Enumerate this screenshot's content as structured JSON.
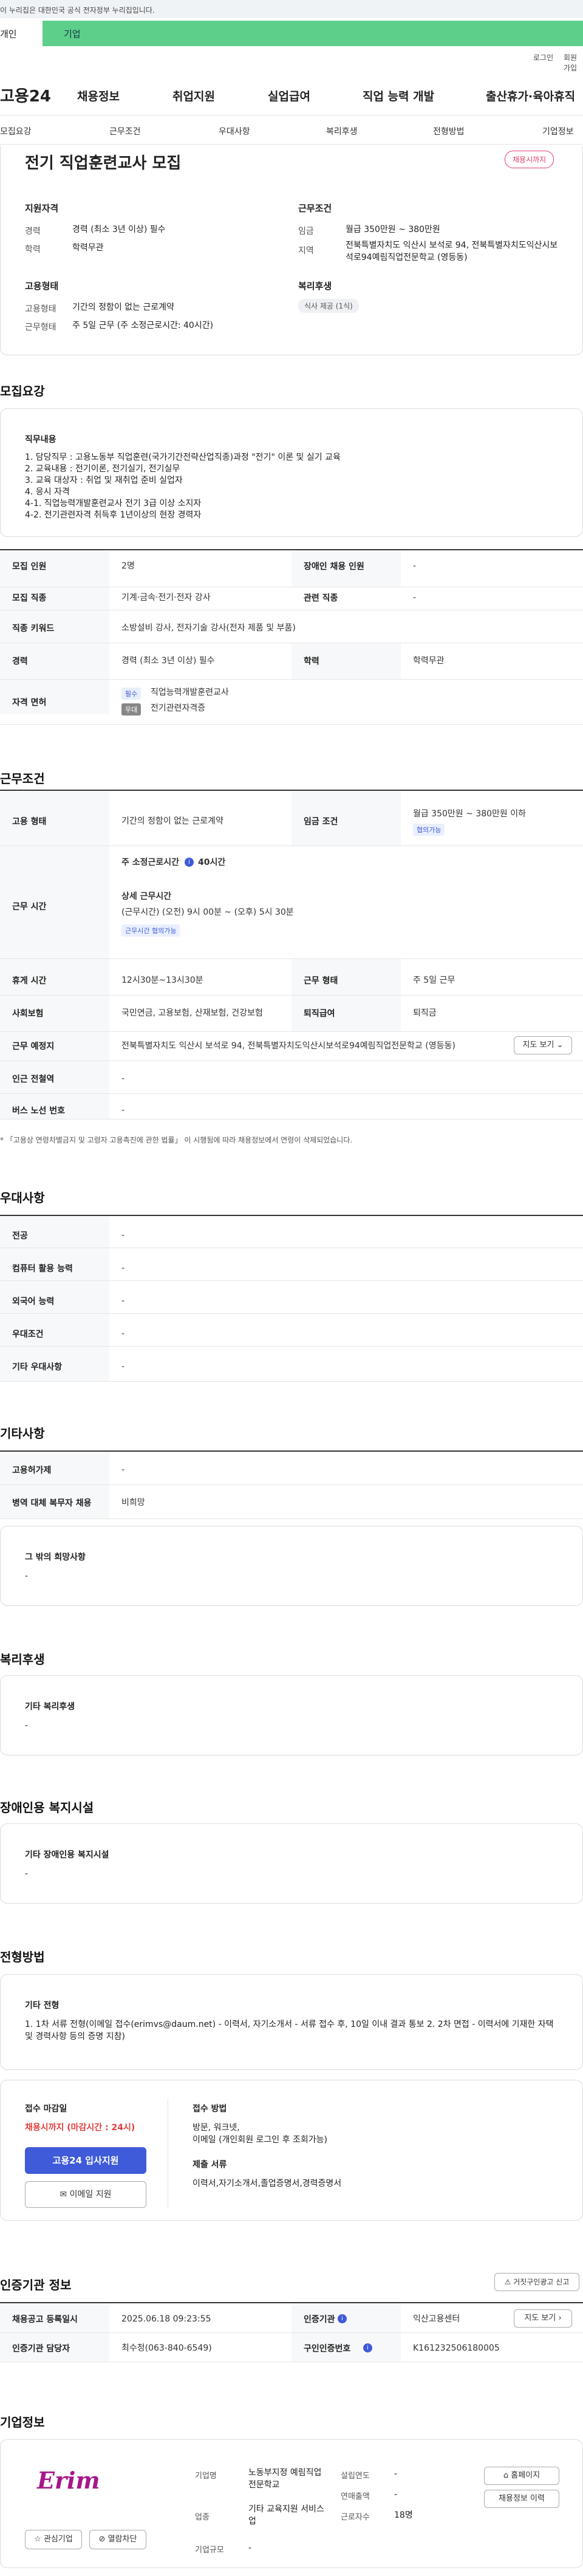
{
  "top_banner": {
    "text": "이 누리집은 대한민국 공식 전자정부 누리집입니다."
  },
  "gov_tabs": [
    "개인",
    "기업"
  ],
  "utils": {
    "login": "로그인",
    "signup": "회원가입"
  },
  "gnb": {
    "logo": "고용24",
    "menus": [
      "채용정보",
      "취업지원",
      "실업급여",
      "직업 능력 개발",
      "출산휴가·육아휴직"
    ]
  },
  "anchors": [
    "모집요강",
    "근무조건",
    "우대사항",
    "복리후생",
    "전형방법",
    "기업정보"
  ],
  "summary": {
    "title": "전기 직업훈련교사 모집",
    "status": "채용시까지",
    "left_section": "지원자격",
    "career_label": "경력",
    "career_value": "경력 (최소 3년 이상) 필수",
    "edu_label": "학력",
    "edu_value": "학력무관",
    "right_section": "근무조건",
    "wage_label": "임금",
    "wage_value": "월급 350만원 ~ 380만원",
    "area_label": "지역",
    "area_value": "전북특별자치도 익산시 보석로 94, 전북특별자치도익산시보석로94예림직업전문학교 (영등동)",
    "emp_section": "고용형태",
    "emp_label": "고용형태",
    "emp_value": "기간의 정함이 없는 근로계약",
    "work_label": "근무형태",
    "work_value": "주 5일 근무 (주 소정근로시간: 40시간)",
    "welfare_section": "복리후생",
    "welfare_chip": "식사 제공 (1식)"
  },
  "recruit": {
    "heading": "모집요강",
    "duty_title": "직무내용",
    "duty_lines": [
      "1. 담당직무 : 고용노동부 직업훈련(국가기간전략산업직종)과정 \"전기\" 이론 및 실기 교육",
      "2. 교육내용 : 전기이론, 전기실기, 전기실무",
      "3. 교육 대상자 : 취업 및 재취업 준비 실업자",
      "4. 응시 자격",
      "4-1. 직업능력개발훈련교사 전기 3급 이상 소지자",
      "4-2. 전기관련자격 취득후 1년이상의 현장 경력자"
    ],
    "rows": [
      {
        "th": "모집 인원",
        "td": "2명",
        "th2": "장애인 채용 인원",
        "td2": "-"
      },
      {
        "th": "모집 직종",
        "td": "기계·금속·전기·전자 강사",
        "th2": "관련 직종",
        "td2": "-"
      },
      {
        "th": "직종 키워드",
        "td": "소방설비 강사, 전자기술 강사(전자 제품 및 부품)"
      },
      {
        "th": "경력",
        "td": "경력 (최소 3년 이상) 필수",
        "th2": "학력",
        "td2": "학력무관"
      }
    ],
    "license_th": "자격 면허",
    "license_tag1": "필수",
    "license_v1": "직업능력개발훈련교사",
    "license_tag2": "우대",
    "license_v2": "전기관련자격증"
  },
  "conditions": {
    "heading": "근무조건",
    "emp_th": "고용 형태",
    "emp_td": "기간의 정함이 없는 근로계약",
    "wage_th": "임금 조건",
    "wage_td": "월급 350만원 ~ 380만원 이하",
    "wage_tag": "협의가능",
    "time_th": "근무 시간",
    "time_week": "주 소정근로시간",
    "time_week_val": "40시간",
    "time_detail_title": "상세 근무시간",
    "time_detail": "(근무시간) (오전) 9시 00분 ~ (오후) 5시 30분",
    "time_tag": "근무시간 협의가능",
    "rest_th": "휴게 시간",
    "rest_td": "12시30분~13시30분",
    "type_th": "근무 형태",
    "type_td": "주 5일 근무",
    "ins_th": "사회보험",
    "ins_td": "국민연금, 고용보험, 산재보험, 건강보험",
    "ret_th": "퇴직급여",
    "ret_td": "퇴직금",
    "place_th": "근무 예정지",
    "place_td": "전북특별자치도 익산시 보석로 94, 전북특별자치도익산시보석로94예림직업전문학교 (영등동)",
    "map_btn": "지도 보기",
    "subway_th": "인근 전철역",
    "subway_td": "-",
    "bus_th": "버스 노선 번호",
    "bus_td": "-",
    "note": "* 「고용상 연령차별금지 및 고령자 고용촉진에 관한 법률」 이 시행됨에 따라 채용정보에서 연령이 삭제되었습니다."
  },
  "pref": {
    "heading": "우대사항",
    "rows": [
      {
        "th": "전공",
        "td": "-"
      },
      {
        "th": "컴퓨터 활용 능력",
        "td": "-"
      },
      {
        "th": "외국어 능력",
        "td": "-"
      },
      {
        "th": "우대조건",
        "td": "-"
      },
      {
        "th": "기타 우대사항",
        "td": "-"
      }
    ]
  },
  "etc": {
    "heading": "기타사항",
    "rows": [
      {
        "th": "고용허가제",
        "td": "-"
      },
      {
        "th": "병역 대체 복무자 채용",
        "td": "비희망"
      }
    ],
    "box_title": "그 밖의 희망사항",
    "box_value": "-"
  },
  "welfare": {
    "heading": "복리후생",
    "box_title": "기타 복리후생",
    "box_value": "-"
  },
  "disabled": {
    "heading": "장애인용 복지시설",
    "box_title": "기타 장애인용 복지시설",
    "box_value": "-"
  },
  "process": {
    "heading": "전형방법",
    "etc_title": "기타 전형",
    "etc_value": "1. 1차 서류 전형(이메일 접수(erimvs@daum.net) - 이력서, 자기소개서 - 서류 접수 후, 10일 이내 결과 통보 2. 2차 면접 - 이력서에 기재한 자택 및 경력사항 등의 증명 지참)",
    "deadline_title": "접수 마감일",
    "deadline_value": "채용시까지 (마감시간 : 24시)",
    "apply_btn": "고용24 입사지원",
    "email_btn": "이메일 지원",
    "method_title": "접수 방법",
    "method_value": "방문, 워크넷,",
    "method_value2": "이메일 (개인회원 로그인 후 조회가능)",
    "docs_title": "제출 서류",
    "docs_value": "이력서,자기소개서,졸업증명서,경력증명서"
  },
  "cert": {
    "heading": "인증기관 정보",
    "report_btn": "거짓구인광고 신고",
    "rows": [
      {
        "th": "채용공고 등록일시",
        "td": "2025.06.18 09:23:55",
        "th2": "인증기관",
        "td2": "익산고용센터"
      },
      {
        "th": "인증기관 담당자",
        "td": "최수정(063-840-6549)",
        "th2": "구인인증번호",
        "td2": "K161232506180005"
      }
    ],
    "map_btn": "지도 보기"
  },
  "company": {
    "heading": "기업정보",
    "logo_text": "Erim",
    "industry_label": "기업명",
    "industry_value": "노동부지정 예림직업전문학교",
    "biz_label": "업종",
    "biz_value": "기타 교육지원 서비스업",
    "scale_label": "기업규모",
    "scale_value": "-",
    "est_label": "설립연도",
    "est_value": "-",
    "sales_label": "연매출액",
    "sales_value": "-",
    "emp_label": "근로자수",
    "emp_value": "18명",
    "fav_btn": "관심기업",
    "block_btn": "열람차단",
    "home_btn": "홈페이지",
    "history_btn": "채용정보 이력"
  }
}
